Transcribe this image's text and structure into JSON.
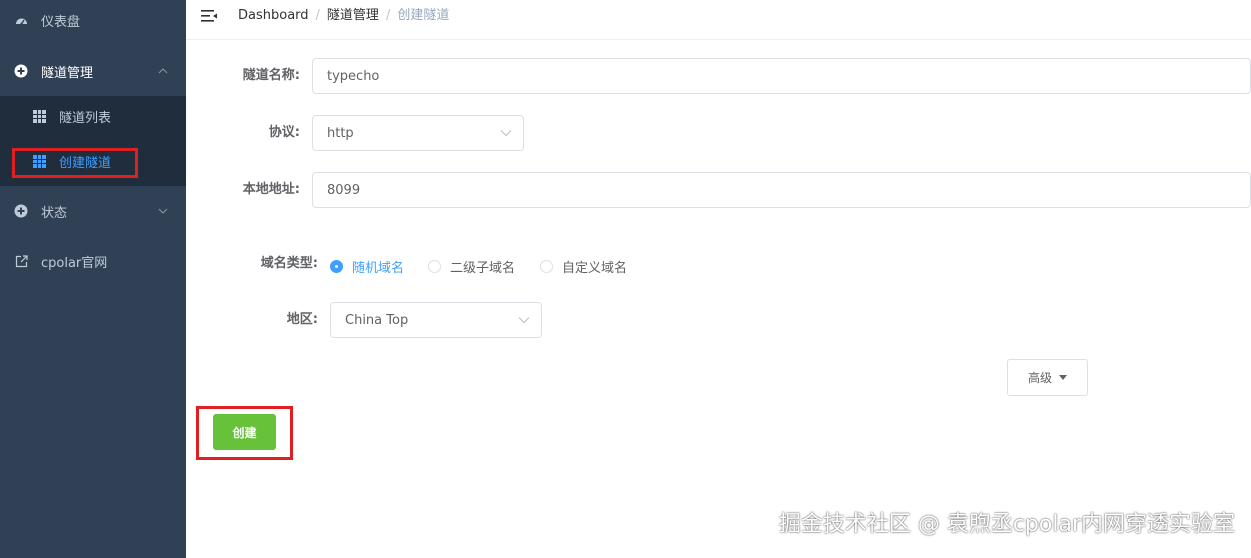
{
  "sidebar": {
    "dashboard": {
      "label": "仪表盘",
      "icon": "dashboard-icon"
    },
    "tunnel_mgmt": {
      "label": "隧道管理",
      "icon": "plus-circle-icon",
      "expanded": true
    },
    "tunnel_list": {
      "label": "隧道列表",
      "icon": "grid-icon"
    },
    "create_tunnel": {
      "label": "创建隧道",
      "icon": "grid-icon",
      "active": true
    },
    "status": {
      "label": "状态",
      "icon": "plus-circle-icon"
    },
    "cpolar_site": {
      "label": "cpolar官网",
      "icon": "external-link-icon"
    }
  },
  "breadcrumb": [
    "Dashboard",
    "隧道管理",
    "创建隧道"
  ],
  "form": {
    "tunnel_name": {
      "label": "隧道名称:",
      "value": "typecho"
    },
    "protocol": {
      "label": "协议:",
      "value": "http"
    },
    "local_address": {
      "label": "本地地址:",
      "value": "8099"
    },
    "domain_type": {
      "label": "域名类型:",
      "options": [
        "随机域名",
        "二级子域名",
        "自定义域名"
      ],
      "selected": "随机域名"
    },
    "region": {
      "label": "地区:",
      "value": "China Top"
    }
  },
  "buttons": {
    "advanced": "高级",
    "create": "创建"
  },
  "watermark": "掘金技术社区 @ 袁煦丞cpolar内网穿透实验室",
  "colors": {
    "sidebar_bg": "#304156",
    "submenu_bg": "#1f2d3d",
    "active": "#409eff",
    "primary_green": "#67c23a",
    "highlight_red": "#e02020"
  }
}
